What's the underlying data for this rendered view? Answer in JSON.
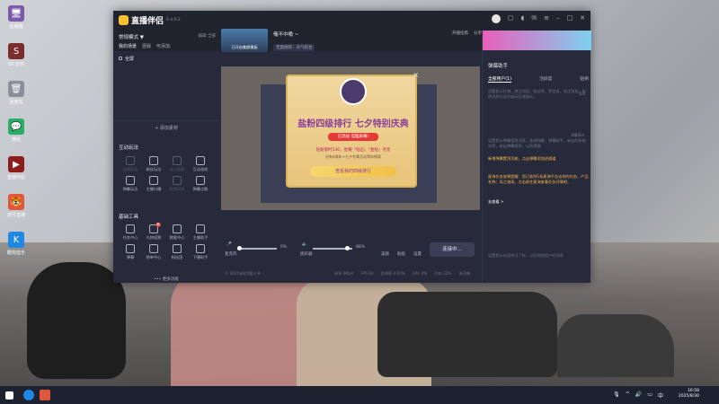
{
  "desktop": {
    "icons": [
      {
        "label": "此电脑",
        "color": "#7a5aa8",
        "glyph": "🖥"
      },
      {
        "label": "SX 软件",
        "color": "#7b2c2c",
        "glyph": "S"
      },
      {
        "label": "回收站",
        "color": "#8a8f99",
        "glyph": "🗑"
      },
      {
        "label": "微信",
        "color": "#2aae67",
        "glyph": "💬"
      },
      {
        "label": "直播伴侣",
        "color": "#8b1d1d",
        "glyph": "▶"
      },
      {
        "label": "虎牙直播",
        "color": "#e0573a",
        "glyph": "🐯"
      },
      {
        "label": "酷狗音乐",
        "color": "#1e88e5",
        "glyph": "K"
      }
    ]
  },
  "window": {
    "app_name": "直播伴侣",
    "version": "6.4.9.2",
    "left": {
      "mode": "常规模式 ▼",
      "edit": "编辑",
      "all": "全部",
      "scene_title": "我的场景",
      "scene_tabs": [
        "竖版",
        "可添加"
      ],
      "scene_item": "全屏",
      "add_source": "+ 添加素材",
      "interact_title": "互动玩法",
      "interact": [
        {
          "l": "连线玩法",
          "d": true
        },
        {
          "l": "粉丝玩法",
          "d": false
        },
        {
          "l": "多人连屏",
          "d": true
        },
        {
          "l": "互动游戏",
          "d": false
        },
        {
          "l": "弹幕玩法",
          "d": false
        },
        {
          "l": "主播口播",
          "d": false
        },
        {
          "l": "礼物玩法",
          "d": true
        },
        {
          "l": "弹幕点歌",
          "d": false
        }
      ],
      "tools_title": "基础工具",
      "tools": [
        {
          "l": "任务中心",
          "b": ""
        },
        {
          "l": "礼物投票",
          "b": "新"
        },
        {
          "l": "数据中心",
          "b": ""
        },
        {
          "l": "主播助手",
          "b": ""
        },
        {
          "l": "弹幕",
          "b": ""
        },
        {
          "l": "榜单中心",
          "b": ""
        },
        {
          "l": "粉丝团",
          "b": ""
        },
        {
          "l": "下播助手",
          "b": ""
        }
      ],
      "more": "••• 更多功能"
    },
    "mid": {
      "thumb_label": "已开启美颜模板",
      "title": "俺不中嘞 ~",
      "category": "无类别的 - 天气综合",
      "links": [
        "开播指南",
        "分享"
      ],
      "popup": {
        "title": "盐粉四级排行 七夕特别庆典",
        "btn": "已添加 电脑屏幕!",
        "text1": "钻粉限时130，星耀『钻石』『金钻』点亮",
        "text2": "另有4周年+七夕专属活动等你探索",
        "cta": "查看我的四级排行"
      },
      "mic_label": "麦克风",
      "mic_val": "0%",
      "spk_label": "扬声器",
      "spk_val": "88%",
      "beauty": "美颜",
      "stickers": "贴纸",
      "settings": "设置",
      "start": "连接中...",
      "status": "© 2025年8月猫人节",
      "stats": [
        "码率 0Kb/s",
        "FPS 60",
        "丢帧率 0.00%",
        "CPU 4%",
        "内存 22%",
        "未开播"
      ]
    },
    "right": {
      "head": "弹幕助手",
      "tabs": [
        "全部用户(1)",
        "活跃度",
        "贴刷"
      ],
      "txt1": "设置显示礼物、关注消息，粉丝等，等信息，关注消息，贴刷消息也会在展示区域展示。",
      "count1": "0.0",
      "txt2": "设置显示弹幕相关消息，连接弹幕，弹幕助手，新出的系统消息，新出弹幕帮助，以防提醒",
      "count2": "0条/0人",
      "hl1": "新增弹幕置顶功能，点击弹幕添加进通道",
      "hl2": "星海任务效果提醒：您已收到1条星海平台派发的任务，产品名称：风之旅再，点击前往星海查看任务详情吧。",
      "hl3": "去查看 >",
      "txt3": "设置显示欢迎关注了你，以及其他用户的消息"
    }
  },
  "taskbar": {
    "time": "16:58",
    "date": "2025/8/30"
  }
}
